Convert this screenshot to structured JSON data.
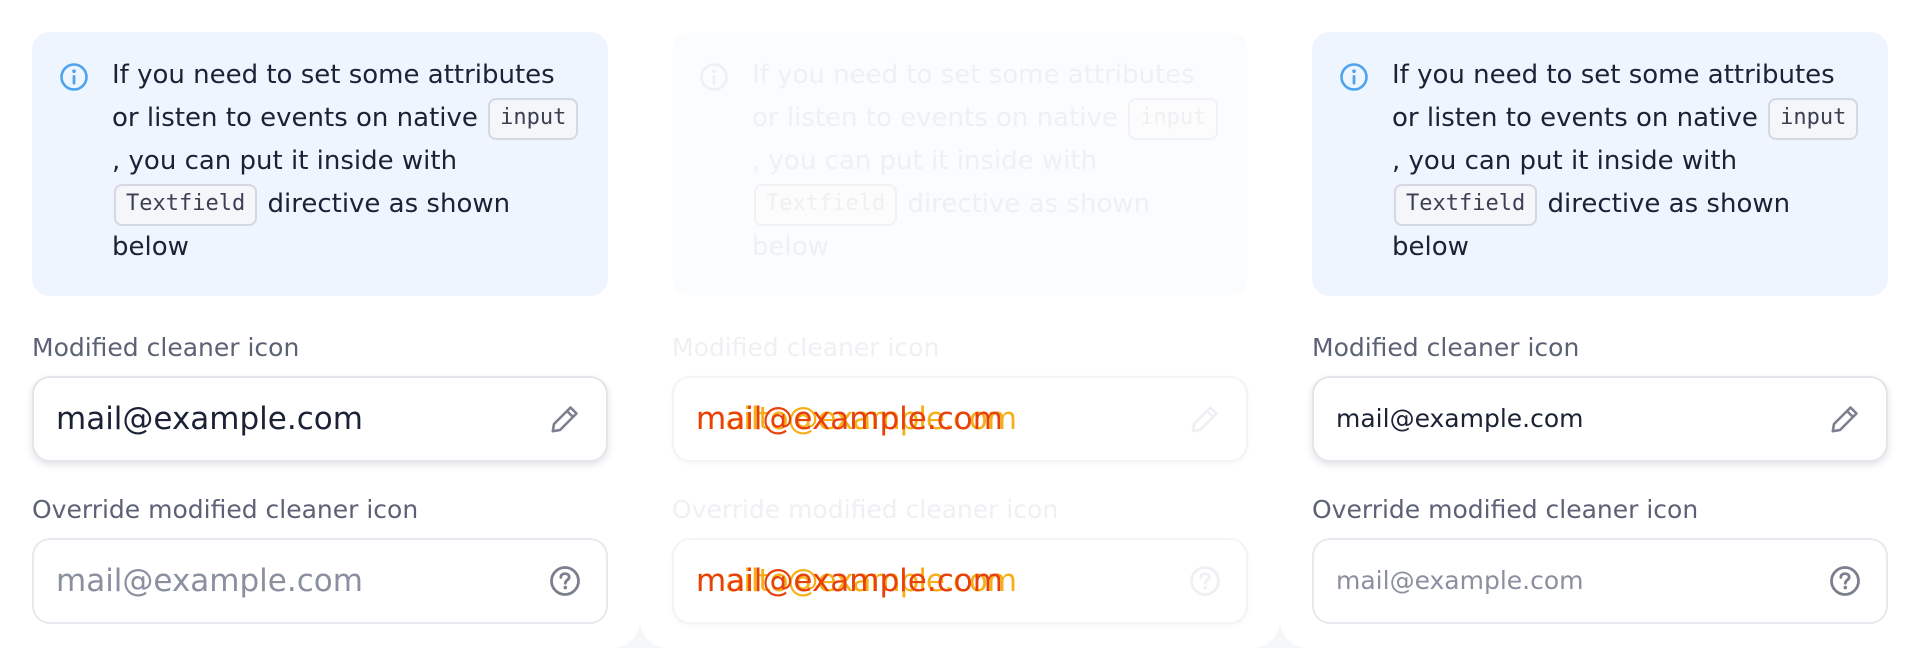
{
  "columns": [
    {
      "note": {
        "icon": "info-circle-icon",
        "text_1": "If you need to set some attributes or listen to events on native",
        "code_1": "input",
        "text_2": ", you can put it inside with",
        "code_2": "Textfield",
        "text_3": "directive as shown below"
      },
      "field_1": {
        "label": "Modified cleaner icon",
        "value": "mail@example.com",
        "icon": "pencil-icon"
      },
      "field_2": {
        "label": "Override modified cleaner icon",
        "placeholder": "mail@example.com",
        "icon": "question-circle-icon"
      }
    },
    {
      "note": {
        "icon": "info-circle-icon",
        "text_1": "If you need to set some attributes or listen to events on native",
        "code_1": "input",
        "text_2": ", you can put it inside with",
        "code_2": "Textfield",
        "text_3": "directive as shown below"
      },
      "field_1": {
        "label": "Modified cleaner icon",
        "value": "mail@example.com",
        "ghost": "mailto@example.com",
        "icon": "pencil-icon"
      },
      "field_2": {
        "label": "Override modified cleaner icon",
        "value": "mail@example.com",
        "ghost": "mailto@example.com",
        "icon": "question-circle-icon"
      }
    },
    {
      "note": {
        "icon": "info-circle-icon",
        "text_1": "If you need to set some attributes or listen to events on native",
        "code_1": "input",
        "text_2": ", you can put it inside with",
        "code_2": "Textfield",
        "text_3": "directive as shown below"
      },
      "field_1": {
        "label": "Modified cleaner icon",
        "value": "mail@example.com",
        "icon": "pencil-icon"
      },
      "field_2": {
        "label": "Override modified cleaner icon",
        "placeholder": "mail@example.com",
        "icon": "question-circle-icon"
      }
    }
  ],
  "colors": {
    "note_background": "#eef5fe",
    "info_icon": "#4da3ee",
    "text": "#1b2236",
    "label": "#5c6275",
    "placeholder": "#8b90a0",
    "icon": "#7b7f8e",
    "overlay_orange": "#e8400a",
    "overlay_yellow": "#f5a800"
  }
}
